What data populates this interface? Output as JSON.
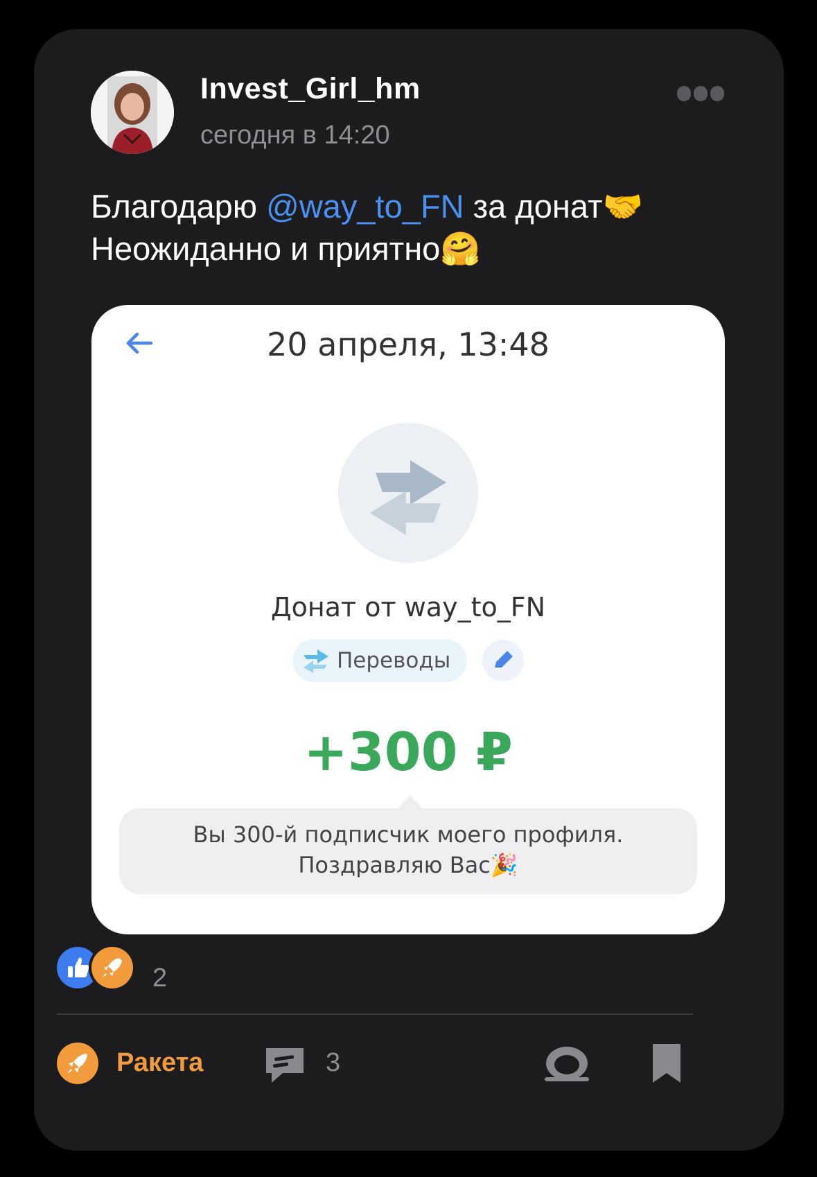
{
  "post": {
    "author": "Invest_Girl_hm",
    "time": "сегодня в 14:20",
    "text_prefix": "Благодарю ",
    "mention": "@way_to_FN",
    "text_suffix": "  за донат",
    "emoji_handshake": "🤝",
    "text_line2": "Неожиданно и приятно",
    "emoji_hug": "🤗"
  },
  "screenshot": {
    "date": "20 апреля, 13:48",
    "title": "Донат от way_to_FN",
    "category": "Переводы",
    "amount": "+300 ₽",
    "message_line1": "Вы 300-й подписчик моего профиля.",
    "message_line2": "Поздравляю Вас",
    "emoji_party": "🎉",
    "colors": {
      "amount": "#3aa85a",
      "back_arrow": "#4a86e8"
    }
  },
  "reactions": {
    "count": "2",
    "icons": [
      "thumbs-up-icon",
      "rocket-icon"
    ]
  },
  "actions": {
    "rocket_label": "Ракета",
    "comments_count": "3",
    "icons": [
      "rocket-icon",
      "comment-icon",
      "share-icon",
      "bookmark-icon"
    ]
  },
  "colors": {
    "background": "#000000",
    "card": "#1c1c1e",
    "mention": "#4a90f0",
    "accent_orange": "#f29b3c"
  }
}
